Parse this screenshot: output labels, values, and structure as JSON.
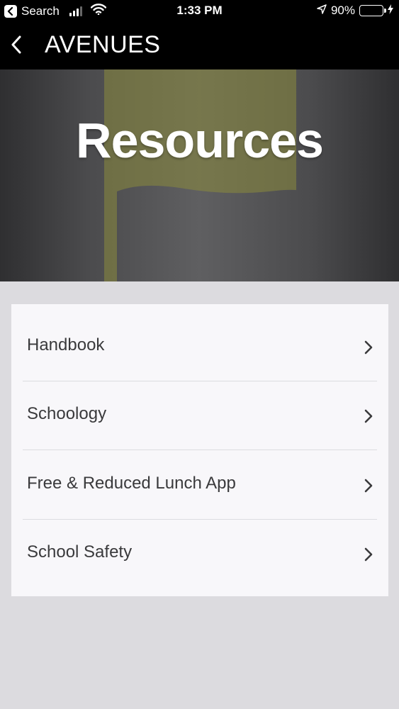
{
  "status_bar": {
    "back_app_label": "Search",
    "time": "1:33 PM",
    "battery_percent": "90%",
    "battery_level": 0.9,
    "battery_color": "#4cd964"
  },
  "nav": {
    "back_icon": "chevron-left-icon",
    "title": "AVENUES"
  },
  "banner": {
    "title": "Resources",
    "flag_color": "#8a8a3c"
  },
  "list": {
    "items": [
      {
        "label": "Handbook",
        "icon": "chevron-right-icon"
      },
      {
        "label": "Schoology",
        "icon": "chevron-right-icon"
      },
      {
        "label": "Free & Reduced Lunch App",
        "icon": "chevron-right-icon"
      },
      {
        "label": "School Safety",
        "icon": "chevron-right-icon"
      }
    ]
  }
}
